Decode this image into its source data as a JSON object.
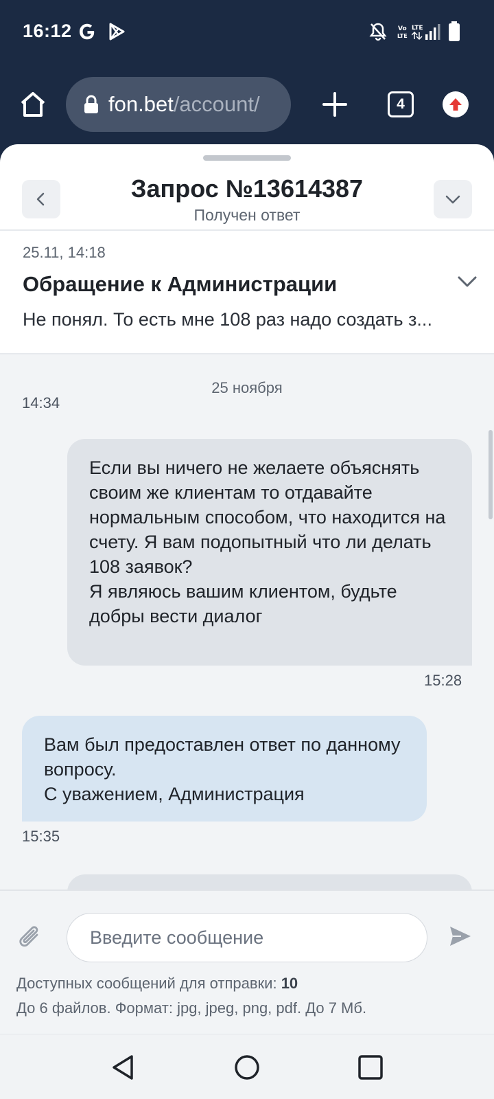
{
  "status_bar": {
    "time": "16:12",
    "left_icons": [
      "google-icon",
      "play-store-icon"
    ],
    "right_icons": [
      "bell-off-icon",
      "volte-icon",
      "lte-signal-icon",
      "battery-icon"
    ]
  },
  "browser": {
    "url_host": "fon.bet",
    "url_path": "/account/",
    "tab_count": "4"
  },
  "header": {
    "title": "Запрос №13614387",
    "subtitle": "Получен ответ"
  },
  "topic": {
    "date": "25.11, 14:18",
    "title": "Обращение к Администрации",
    "preview": "Не понял. То есть мне 108 раз надо создать з..."
  },
  "chat": {
    "date_separator": "25 ноября",
    "messages": [
      {
        "direction": "incoming",
        "time": "14:34",
        "text": ""
      },
      {
        "direction": "outgoing",
        "time": "15:28",
        "text": "Если вы ничего не желаете объяснять своим же клиентам то отдавайте нормальным способом, что находится на счету. Я вам подопытный что ли делать 108 заявок?\nЯ являюсь вашим клиентом, будьте добры вести диалог"
      },
      {
        "direction": "incoming",
        "time": "15:35",
        "text": "Вам был предоставлен ответ по данному вопросу.\nС уважением, Администрация"
      }
    ]
  },
  "composer": {
    "placeholder": "Введите сообщение",
    "available_label": "Доступных сообщений для отправки: ",
    "available_count": "10",
    "files_info": "До 6 файлов. Формат: jpg, jpeg, png, pdf. До 7 Мб."
  },
  "colors": {
    "top_bar": "#1b2a43",
    "outgoing_bubble": "#dfe3e8",
    "incoming_bubble": "#d7e5f2",
    "accent_red": "#e53935"
  }
}
